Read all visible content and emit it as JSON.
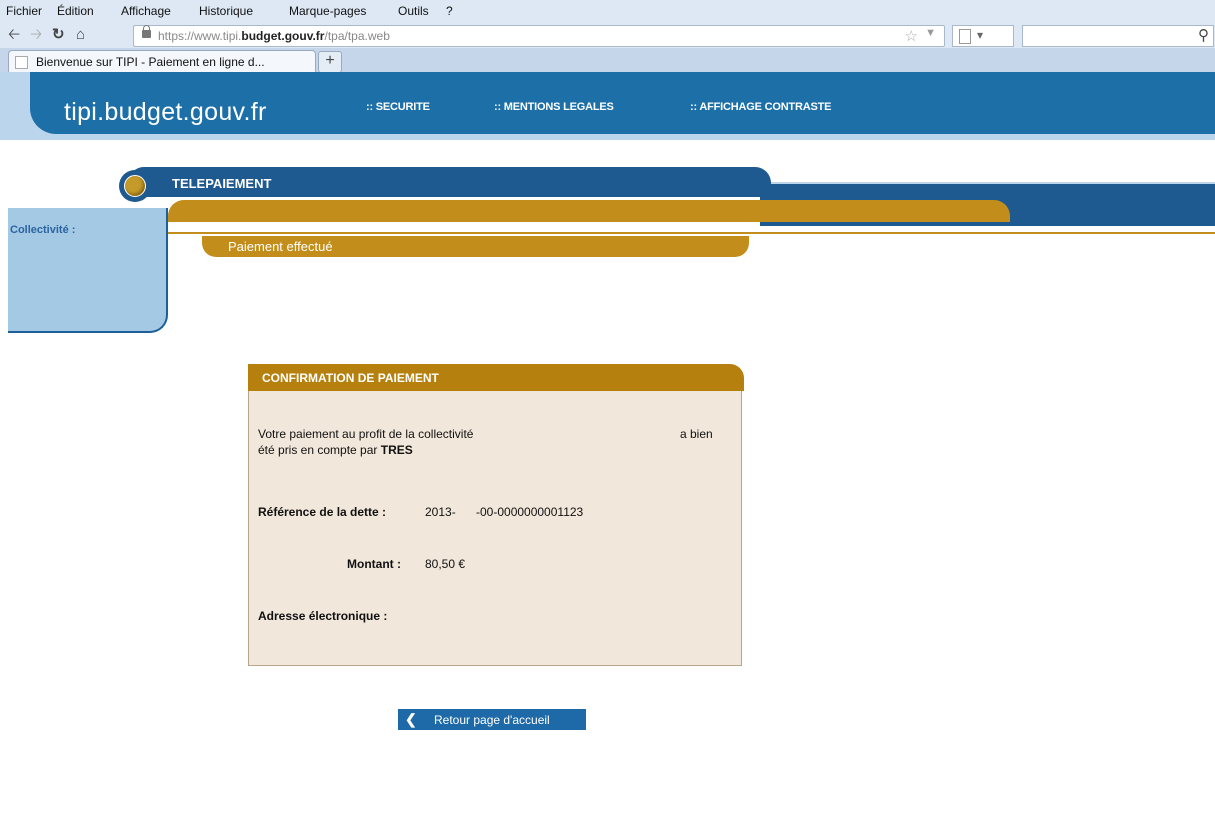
{
  "browser": {
    "menu": [
      "Fichier",
      "Édition",
      "Affichage",
      "Historique",
      "Marque-pages",
      "Outils",
      "?"
    ],
    "url_prefix": "https://www.tipi.",
    "url_domain": "budget.gouv.fr",
    "url_path": "/tpa/tpa.web",
    "tab_title": "Bienvenue sur TIPI - Paiement en ligne d...",
    "new_tab": "+"
  },
  "site": {
    "logo": "tipi.budget.gouv.fr",
    "nav": [
      ":: SECURITE",
      ":: MENTIONS LEGALES",
      ":: AFFICHAGE CONTRASTE"
    ],
    "section_title": "TELEPAIEMENT",
    "side_label": "Collectivité :",
    "step_label": "Paiement effectué"
  },
  "confirmation": {
    "title": "CONFIRMATION DE PAIEMENT",
    "msg_part1": "Votre paiement au profit de la collectivité",
    "msg_part2": "a bien",
    "msg_line2": "été pris en compte par",
    "msg_bold": "TRES",
    "ref_label": "Référence de la dette :",
    "ref_value_a": "2013-",
    "ref_value_b": "-00-0000000001123",
    "amount_label": "Montant :",
    "amount_value": "80,50 €",
    "email_label": "Adresse électronique :"
  },
  "actions": {
    "return_label": "Retour page d'accueil"
  },
  "colors": {
    "blue_dark": "#1e5a90",
    "blue_header": "#1d6fa8",
    "gold": "#c28d1a",
    "panel_bg": "#f1e7db"
  }
}
